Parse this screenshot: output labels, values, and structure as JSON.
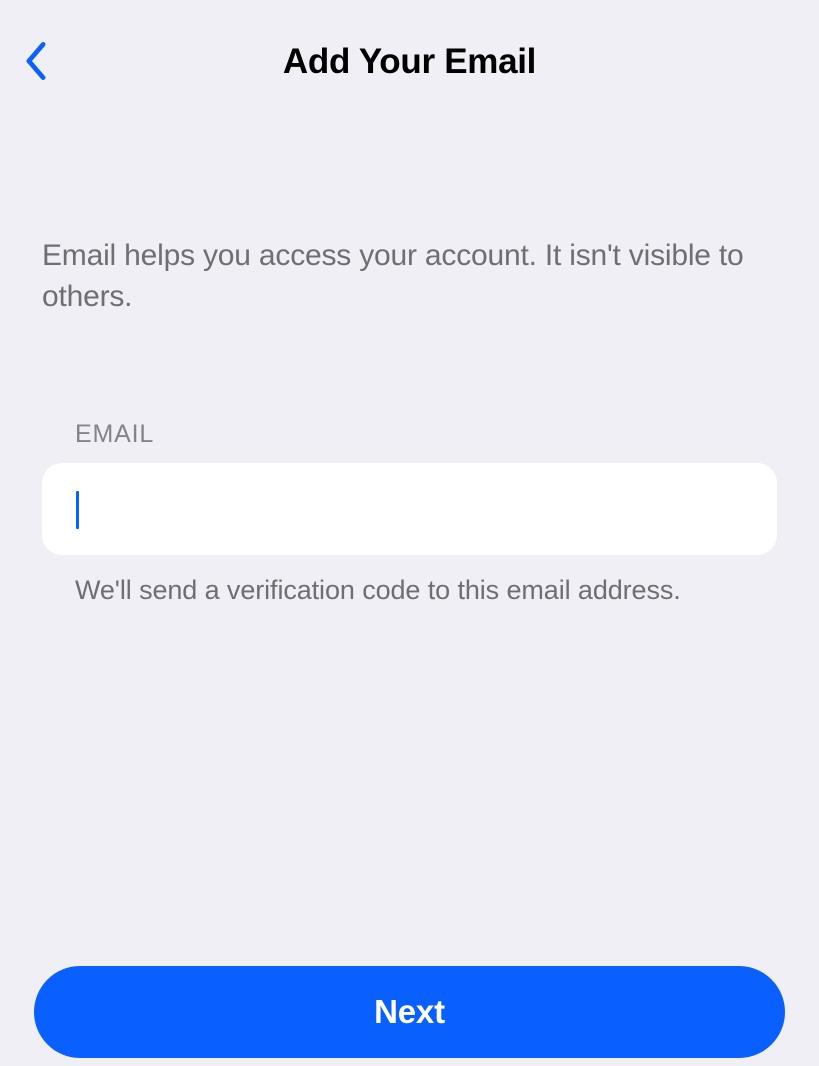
{
  "header": {
    "title": "Add Your Email"
  },
  "main": {
    "description": "Email helps you access your account. It isn't visible to others.",
    "field": {
      "label": "EMAIL",
      "value": "",
      "hint": "We'll send a verification code to this email address."
    }
  },
  "footer": {
    "primary_button_label": "Next"
  },
  "colors": {
    "background": "#F0EFF5",
    "accent": "#0A60FF",
    "text_secondary": "#6E6E73"
  }
}
